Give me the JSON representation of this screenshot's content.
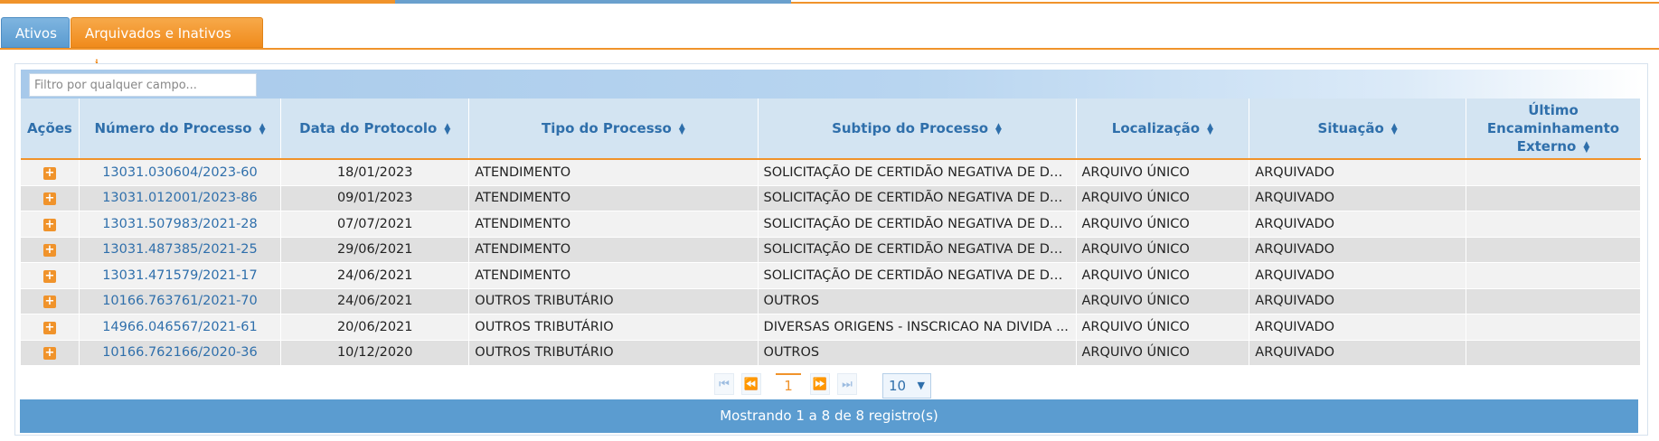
{
  "tabs": {
    "ativos": "Ativos",
    "arquivados": "Arquivados e Inativos"
  },
  "filter": {
    "placeholder": "Filtro por qualquer campo..."
  },
  "table": {
    "headers": {
      "acoes": "Ações",
      "numero": "Número do Processo",
      "data": "Data do Protocolo",
      "tipo": "Tipo do Processo",
      "subtipo": "Subtipo do Processo",
      "localizacao": "Localização",
      "situacao": "Situação",
      "ultimo": "Último Encaminhamento Externo"
    },
    "rows": [
      {
        "numero": "13031.030604/2023-60",
        "data": "18/01/2023",
        "tipo": "ATENDIMENTO",
        "subtipo": "SOLICITAÇÃO DE CERTIDÃO NEGATIVA DE DÉ...",
        "localizacao": "ARQUIVO ÚNICO",
        "situacao": "ARQUIVADO",
        "ultimo": ""
      },
      {
        "numero": "13031.012001/2023-86",
        "data": "09/01/2023",
        "tipo": "ATENDIMENTO",
        "subtipo": "SOLICITAÇÃO DE CERTIDÃO NEGATIVA DE DÉ...",
        "localizacao": "ARQUIVO ÚNICO",
        "situacao": "ARQUIVADO",
        "ultimo": ""
      },
      {
        "numero": "13031.507983/2021-28",
        "data": "07/07/2021",
        "tipo": "ATENDIMENTO",
        "subtipo": "SOLICITAÇÃO DE CERTIDÃO NEGATIVA DE DÉ...",
        "localizacao": "ARQUIVO ÚNICO",
        "situacao": "ARQUIVADO",
        "ultimo": ""
      },
      {
        "numero": "13031.487385/2021-25",
        "data": "29/06/2021",
        "tipo": "ATENDIMENTO",
        "subtipo": "SOLICITAÇÃO DE CERTIDÃO NEGATIVA DE DÉ...",
        "localizacao": "ARQUIVO ÚNICO",
        "situacao": "ARQUIVADO",
        "ultimo": ""
      },
      {
        "numero": "13031.471579/2021-17",
        "data": "24/06/2021",
        "tipo": "ATENDIMENTO",
        "subtipo": "SOLICITAÇÃO DE CERTIDÃO NEGATIVA DE DÉ...",
        "localizacao": "ARQUIVO ÚNICO",
        "situacao": "ARQUIVADO",
        "ultimo": ""
      },
      {
        "numero": "10166.763761/2021-70",
        "data": "24/06/2021",
        "tipo": "OUTROS TRIBUTÁRIO",
        "subtipo": "OUTROS",
        "localizacao": "ARQUIVO ÚNICO",
        "situacao": "ARQUIVADO",
        "ultimo": ""
      },
      {
        "numero": "14966.046567/2021-61",
        "data": "20/06/2021",
        "tipo": "OUTROS TRIBUTÁRIO",
        "subtipo": "DIVERSAS ORIGENS - INSCRICAO NA DIVIDA ...",
        "localizacao": "ARQUIVO ÚNICO",
        "situacao": "ARQUIVADO",
        "ultimo": ""
      },
      {
        "numero": "10166.762166/2020-36",
        "data": "10/12/2020",
        "tipo": "OUTROS TRIBUTÁRIO",
        "subtipo": "OUTROS",
        "localizacao": "ARQUIVO ÚNICO",
        "situacao": "ARQUIVADO",
        "ultimo": ""
      }
    ]
  },
  "pager": {
    "current_page": "1",
    "page_size": "10",
    "first": "⏮",
    "prev": "⏪",
    "next": "⏩",
    "last": "⏭"
  },
  "footer": {
    "text": "Mostrando 1 a 8 de 8 registro(s)"
  },
  "colors": {
    "accent": "#f0932b",
    "primary": "#5b9cd0",
    "header_bg": "#d3e4f2",
    "link": "#2f6fab"
  },
  "icons": {
    "info": "info-icon",
    "sort": "sort-icon",
    "expand": "plus-icon",
    "dropdown": "chevron-down-icon"
  }
}
